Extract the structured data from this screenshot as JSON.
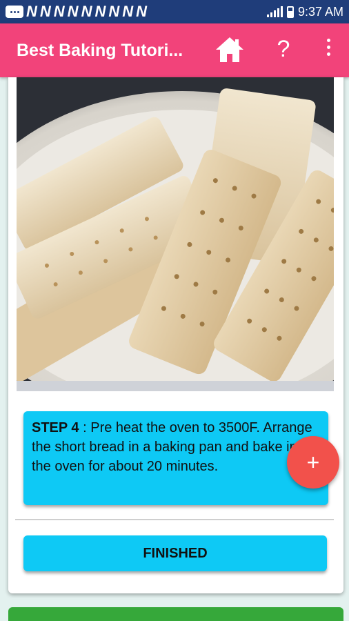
{
  "status_bar": {
    "notification_letters": [
      "N",
      "N",
      "N",
      "N",
      "N",
      "N",
      "N",
      "N",
      "N"
    ],
    "time": "9:37 AM"
  },
  "app_bar": {
    "title": "Best Baking Tutori...",
    "home_icon": "home-icon",
    "help_label": "?",
    "more_icon": "more-vert-icon"
  },
  "step": {
    "label": "STEP 4",
    "text": " : Pre heat the oven to 3500F. Arrange the short bread in a baking pan and bake in the oven for about 20 minutes."
  },
  "finish_button": {
    "label": "FINISHED"
  },
  "fab": {
    "label": "+"
  },
  "colors": {
    "status_bar": "#1f3d7a",
    "app_bar": "#f2437a",
    "accent_box": "#0ec9f5",
    "fab": "#f2514b",
    "bottom_strip": "#36a83a"
  }
}
